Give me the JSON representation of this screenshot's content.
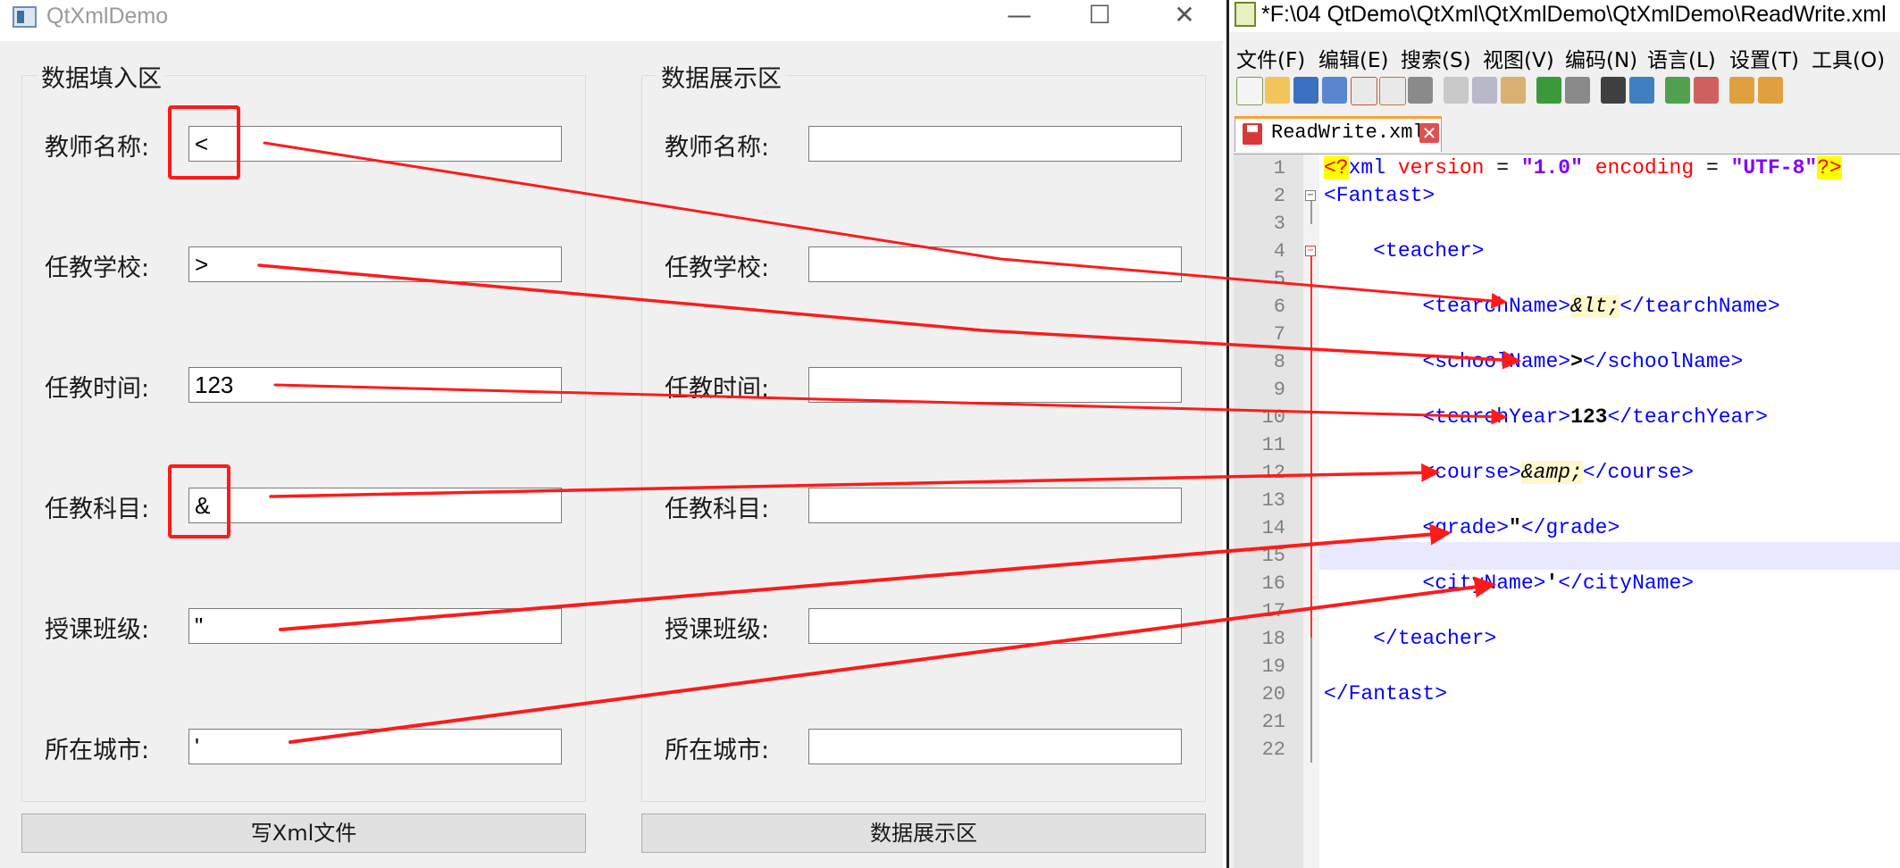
{
  "colors": {
    "annotation": "#ff1a1a",
    "xml_tag": "#0000ff",
    "xml_attr": "#ff0000",
    "xml_value": "#8000ff",
    "npp_tab_accent": "#ffa033"
  },
  "qt_window": {
    "title": "QtXmlDemo",
    "caption_buttons": {
      "minimize": "—",
      "maximize": "☐",
      "close": "✕"
    },
    "input_group": {
      "title": "数据填入区",
      "fields": [
        {
          "label": "教师名称:",
          "value": "<"
        },
        {
          "label": "任教学校:",
          "value": ">"
        },
        {
          "label": "任教时间:",
          "value": "123"
        },
        {
          "label": "任教科目:",
          "value": "&"
        },
        {
          "label": "授课班级:",
          "value": "\""
        },
        {
          "label": "所在城市:",
          "value": "'"
        }
      ],
      "button": "写Xml文件"
    },
    "display_group": {
      "title": "数据展示区",
      "fields": [
        {
          "label": "教师名称:",
          "value": ""
        },
        {
          "label": "任教学校:",
          "value": ""
        },
        {
          "label": "任教时间:",
          "value": ""
        },
        {
          "label": "任教科目:",
          "value": ""
        },
        {
          "label": "授课班级:",
          "value": ""
        },
        {
          "label": "所在城市:",
          "value": ""
        }
      ],
      "button": "数据展示区"
    }
  },
  "notepad": {
    "title": "*F:\\04 QtDemo\\QtXml\\QtXmlDemo\\QtXmlDemo\\ReadWrite.xml",
    "menus": [
      "文件(F)",
      "编辑(E)",
      "搜索(S)",
      "视图(V)",
      "编码(N)",
      "语言(L)",
      "设置(T)",
      "工具(O)"
    ],
    "toolbar_icons": [
      "new-file-icon",
      "open-file-icon",
      "save-icon",
      "save-all-icon",
      "close-icon",
      "close-all-icon",
      "print-icon",
      "cut-icon",
      "copy-icon",
      "paste-icon",
      "undo-icon",
      "redo-icon",
      "find-icon",
      "replace-icon",
      "zoom-in-icon",
      "zoom-out-icon",
      "sync-vertical-icon",
      "sync-horizontal-icon"
    ],
    "tab": {
      "label": "ReadWrite.xml",
      "close": "✕"
    },
    "line_numbers": [
      "1",
      "2",
      "3",
      "4",
      "5",
      "6",
      "7",
      "8",
      "9",
      "10",
      "11",
      "12",
      "13",
      "14",
      "15",
      "16",
      "17",
      "18",
      "19",
      "20",
      "21",
      "22"
    ],
    "current_line": 15,
    "code": {
      "pi_open": "<?",
      "pi_name": "xml",
      "attr_version": "version",
      "eq": " = ",
      "val_version": "\"1.0\"",
      "attr_encoding": "encoding",
      "val_encoding": "\"UTF-8\"",
      "pi_close": "?>",
      "root_open": "<Fantast>",
      "teacher_open": "<teacher>",
      "tn_open": "<tearchName>",
      "tn_value": "&lt;",
      "tn_close": "</tearchName>",
      "sn_open": "<schoolName>",
      "sn_value": ">",
      "sn_close": "</schoolName>",
      "ty_open": "<tearchYear>",
      "ty_value": "123",
      "ty_close": "</tearchYear>",
      "co_open": "<course>",
      "co_value": "&amp;",
      "co_close": "</course>",
      "gr_open": "<grade>",
      "gr_value": "\"",
      "gr_close": "</grade>",
      "cn_open": "<cityName>",
      "cn_value": "'",
      "cn_close": "</cityName>",
      "teacher_close": "</teacher>",
      "root_close": "</Fantast>"
    }
  }
}
